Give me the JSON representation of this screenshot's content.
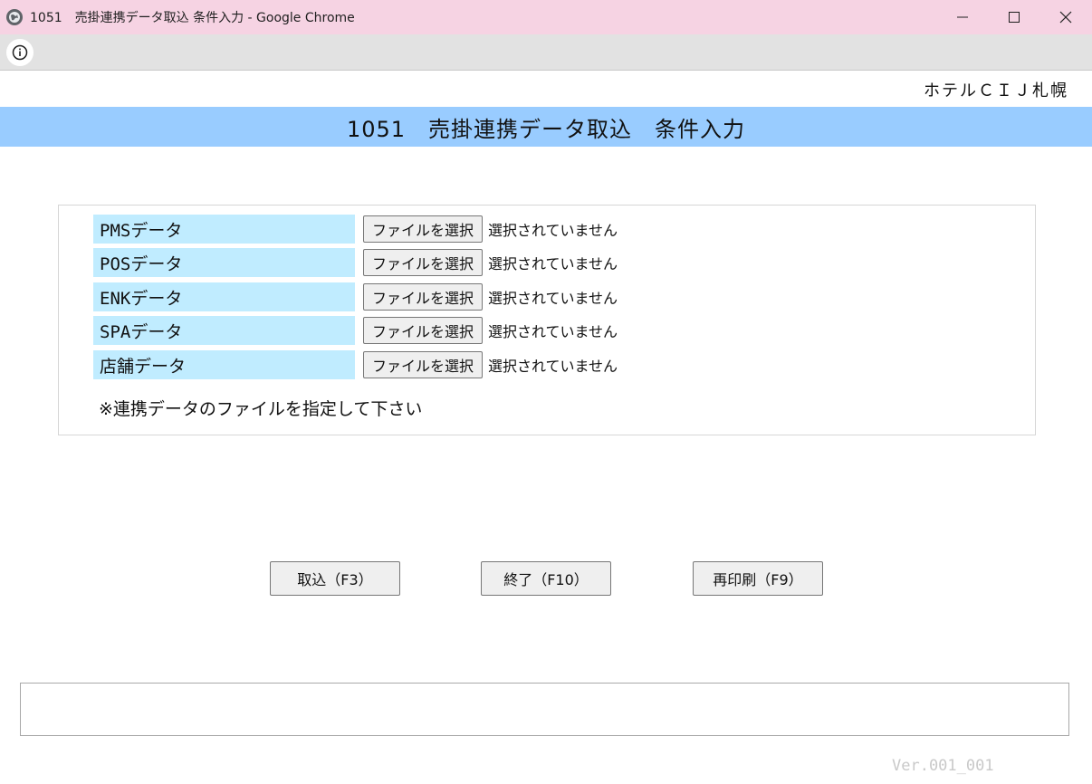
{
  "window": {
    "title": "1051　売掛連携データ取込 条件入力 - Google Chrome",
    "minimize_icon": "minimize-icon",
    "maximize_icon": "maximize-icon",
    "close_icon": "close-icon"
  },
  "addressbar": {
    "info_icon": "info-icon"
  },
  "header": {
    "hotel_name": "ホテルＣＩＪ札幌",
    "page_title": "1051　売掛連携データ取込　条件入力",
    "band_color": "#99ccff"
  },
  "form": {
    "rows": [
      {
        "label": "PMSデータ",
        "button": "ファイルを選択",
        "status": "選択されていません"
      },
      {
        "label": "POSデータ",
        "button": "ファイルを選択",
        "status": "選択されていません"
      },
      {
        "label": "ENKデータ",
        "button": "ファイルを選択",
        "status": "選択されていません"
      },
      {
        "label": "SPAデータ",
        "button": "ファイルを選択",
        "status": "選択されていません"
      },
      {
        "label": "店舗データ",
        "button": "ファイルを選択",
        "status": "選択されていません"
      }
    ],
    "note": "※連携データのファイルを指定して下さい",
    "label_color": "#c0ecff"
  },
  "actions": {
    "import_label": "取込（F3）",
    "exit_label": "終了（F10）",
    "reprint_label": "再印刷（F9）"
  },
  "footer": {
    "message": "",
    "version": "Ver.001_001"
  },
  "colors": {
    "titlebar": "#f6d3e3"
  }
}
